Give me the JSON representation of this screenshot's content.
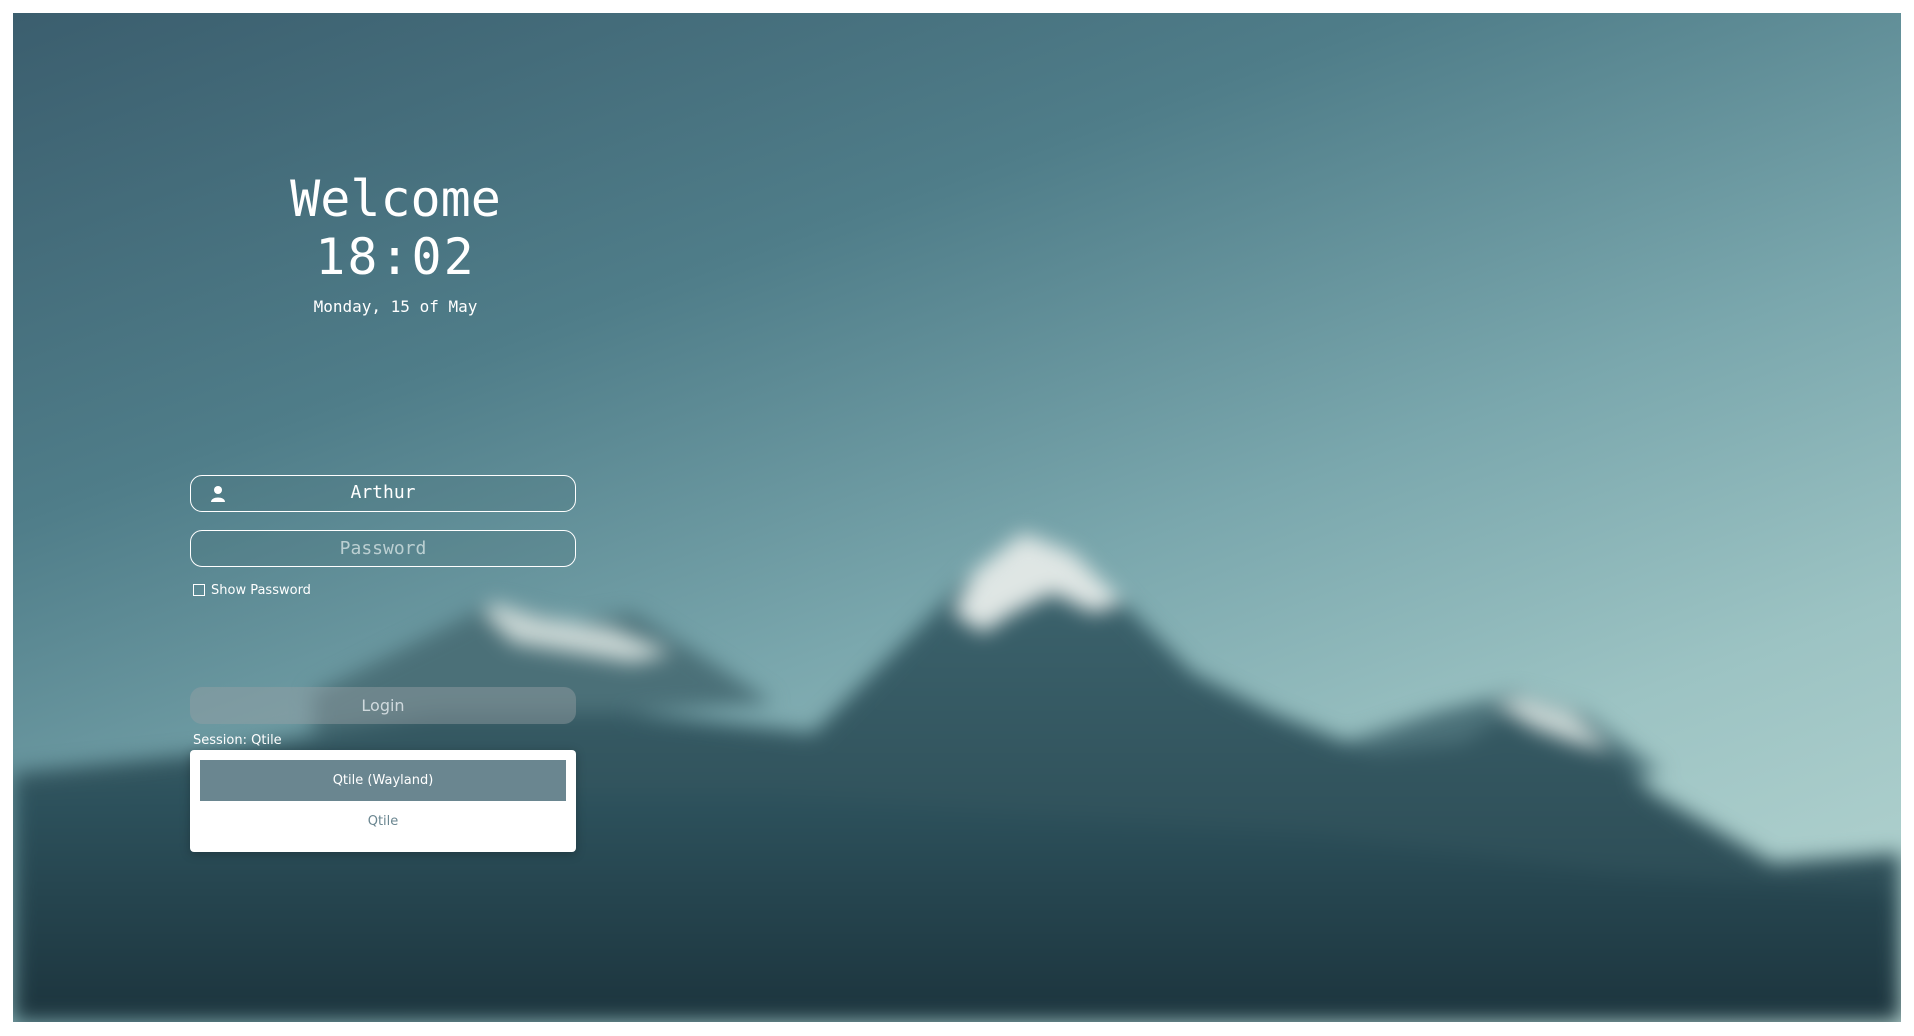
{
  "greeting": "Welcome",
  "clock": "18:02",
  "date": "Monday, 15 of May",
  "login_form": {
    "username": "Arthur",
    "user_icon": "user-icon",
    "password_placeholder": "Password",
    "show_password_label": "Show Password",
    "show_password_checked": false,
    "login_label": "Login"
  },
  "session": {
    "label": "Session:",
    "current": "Qtile",
    "options": [
      "Qtile (Wayland)",
      "Qtile"
    ],
    "highlighted_index": 0
  },
  "colors": {
    "accent": "#6a8690",
    "text": "#ffffff"
  }
}
